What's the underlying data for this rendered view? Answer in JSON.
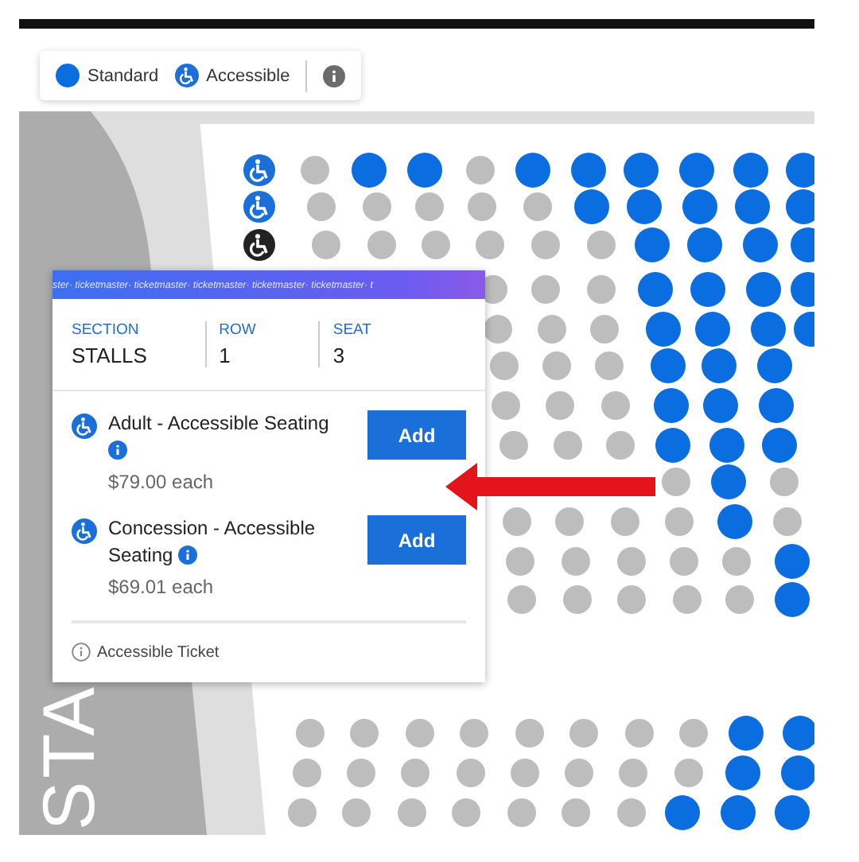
{
  "legend": {
    "items": [
      {
        "kind": "standard",
        "label": "Standard"
      },
      {
        "kind": "accessible",
        "label": "Accessible"
      }
    ]
  },
  "seat_map": {
    "section_label": "STA",
    "rows": [
      {
        "seats": [
          {
            "kind": "accessible"
          },
          {
            "kind": "unavailable"
          },
          {
            "kind": "available"
          },
          {
            "kind": "available"
          },
          {
            "kind": "unavailable"
          },
          {
            "kind": "available"
          },
          {
            "kind": "available"
          },
          {
            "kind": "available"
          },
          {
            "kind": "available"
          },
          {
            "kind": "available"
          },
          {
            "kind": "available"
          }
        ]
      },
      {
        "seats": [
          {
            "kind": "accessible"
          },
          {
            "kind": "unavailable"
          },
          {
            "kind": "unavailable"
          },
          {
            "kind": "unavailable"
          },
          {
            "kind": "unavailable"
          },
          {
            "kind": "unavailable"
          },
          {
            "kind": "available"
          },
          {
            "kind": "available"
          },
          {
            "kind": "available"
          },
          {
            "kind": "available"
          },
          {
            "kind": "available"
          }
        ]
      },
      {
        "seats": [
          {
            "kind": "accessible_selected"
          },
          {
            "kind": "unavailable"
          },
          {
            "kind": "unavailable"
          },
          {
            "kind": "unavailable"
          },
          {
            "kind": "unavailable"
          },
          {
            "kind": "unavailable"
          },
          {
            "kind": "unavailable"
          },
          {
            "kind": "available"
          },
          {
            "kind": "available"
          },
          {
            "kind": "available"
          },
          {
            "kind": "available"
          }
        ]
      },
      {
        "seats": [
          {
            "kind": "unavailable"
          },
          {
            "kind": "unavailable"
          },
          {
            "kind": "unavailable"
          },
          {
            "kind": "available"
          },
          {
            "kind": "available"
          },
          {
            "kind": "available"
          },
          {
            "kind": "available"
          }
        ]
      },
      {
        "seats": [
          {
            "kind": "unavailable"
          },
          {
            "kind": "unavailable"
          },
          {
            "kind": "unavailable"
          },
          {
            "kind": "available"
          },
          {
            "kind": "available"
          },
          {
            "kind": "available"
          },
          {
            "kind": "available"
          }
        ]
      },
      {
        "seats": [
          {
            "kind": "unavailable"
          },
          {
            "kind": "unavailable"
          },
          {
            "kind": "unavailable"
          },
          {
            "kind": "available"
          },
          {
            "kind": "available"
          },
          {
            "kind": "available"
          }
        ]
      },
      {
        "seats": [
          {
            "kind": "unavailable"
          },
          {
            "kind": "unavailable"
          },
          {
            "kind": "unavailable"
          },
          {
            "kind": "available"
          },
          {
            "kind": "available"
          },
          {
            "kind": "available"
          }
        ]
      },
      {
        "seats": [
          {
            "kind": "unavailable"
          },
          {
            "kind": "unavailable"
          },
          {
            "kind": "unavailable"
          },
          {
            "kind": "available"
          },
          {
            "kind": "available"
          },
          {
            "kind": "available"
          }
        ]
      },
      {
        "seats": [
          {
            "kind": "unavailable"
          },
          {
            "kind": "available"
          },
          {
            "kind": "unavailable"
          }
        ]
      },
      {
        "seats": [
          {
            "kind": "unavailable"
          },
          {
            "kind": "unavailable"
          },
          {
            "kind": "unavailable"
          },
          {
            "kind": "unavailable"
          },
          {
            "kind": "available"
          },
          {
            "kind": "unavailable"
          }
        ]
      },
      {
        "seats": [
          {
            "kind": "unavailable"
          },
          {
            "kind": "unavailable"
          },
          {
            "kind": "unavailable"
          },
          {
            "kind": "unavailable"
          },
          {
            "kind": "unavailable"
          },
          {
            "kind": "available"
          }
        ]
      },
      {
        "seats": [
          {
            "kind": "unavailable"
          },
          {
            "kind": "unavailable"
          },
          {
            "kind": "unavailable"
          },
          {
            "kind": "unavailable"
          },
          {
            "kind": "unavailable"
          },
          {
            "kind": "available"
          }
        ]
      },
      {
        "seats": [
          {
            "kind": "unavailable"
          },
          {
            "kind": "unavailable"
          },
          {
            "kind": "unavailable"
          },
          {
            "kind": "unavailable"
          },
          {
            "kind": "unavailable"
          },
          {
            "kind": "unavailable"
          },
          {
            "kind": "unavailable"
          },
          {
            "kind": "unavailable"
          },
          {
            "kind": "available"
          },
          {
            "kind": "available"
          }
        ]
      },
      {
        "seats": [
          {
            "kind": "unavailable"
          },
          {
            "kind": "unavailable"
          },
          {
            "kind": "unavailable"
          },
          {
            "kind": "unavailable"
          },
          {
            "kind": "unavailable"
          },
          {
            "kind": "unavailable"
          },
          {
            "kind": "unavailable"
          },
          {
            "kind": "unavailable"
          },
          {
            "kind": "available"
          },
          {
            "kind": "available"
          }
        ]
      },
      {
        "seats": [
          {
            "kind": "unavailable"
          },
          {
            "kind": "unavailable"
          },
          {
            "kind": "unavailable"
          },
          {
            "kind": "unavailable"
          },
          {
            "kind": "unavailable"
          },
          {
            "kind": "unavailable"
          },
          {
            "kind": "unavailable"
          },
          {
            "kind": "available"
          },
          {
            "kind": "available"
          },
          {
            "kind": "available"
          }
        ]
      }
    ]
  },
  "seat_popup": {
    "header_text": "ster· ticketmaster· ticketmaster· ticketmaster· ticketmaster· ticketmaster· t",
    "details": [
      {
        "label": "SECTION",
        "value": "STALLS"
      },
      {
        "label": "ROW",
        "value": "1"
      },
      {
        "label": "SEAT",
        "value": "3"
      }
    ],
    "tickets": [
      {
        "name": "Adult - Accessible Seating",
        "price": "$79.00 each",
        "button": "Add"
      },
      {
        "name": "Concession - Accessible Seating",
        "price": "$69.01 each",
        "button": "Add"
      }
    ],
    "footer": "Accessible Ticket"
  }
}
